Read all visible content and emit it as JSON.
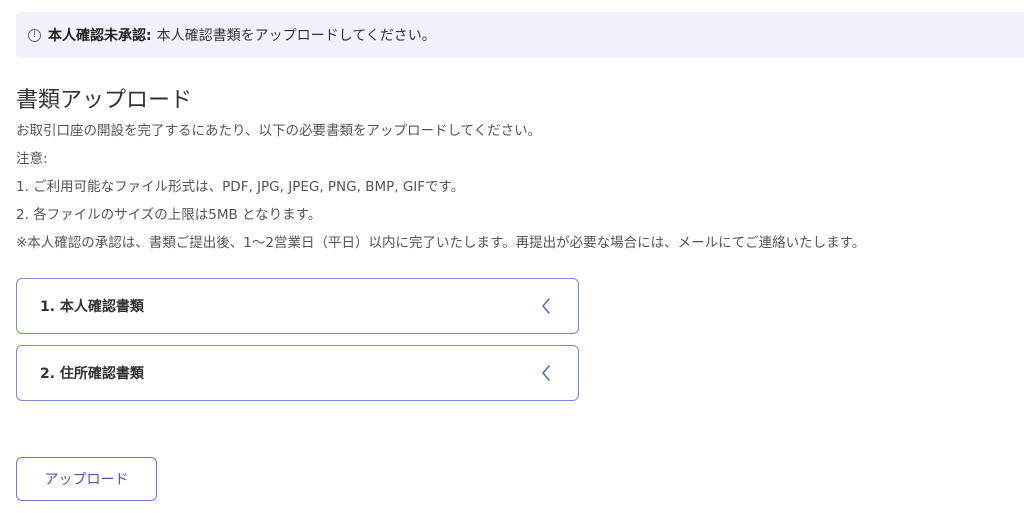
{
  "alert": {
    "icon": "info-circle-icon",
    "icon_glyph": "!",
    "title": "本人確認未承認:",
    "message": "本人確認書類をアップロードしてください。"
  },
  "page": {
    "heading": "書類アップロード",
    "description": "お取引口座の開設を完了するにあたり、以下の必要書類をアップロードしてください。",
    "notice_label": "注意:",
    "notes": [
      "1. ご利用可能なファイル形式は、PDF, JPG, JPEG, PNG, BMP, GIFです。",
      "2. 各ファイルのサイズの上限は5MB となります。",
      "※本人確認の承認は、書類ご提出後、1〜2営業日（平日）以内に完了いたします。再提出が必要な場合には、メールにてご連絡いたします。"
    ]
  },
  "documents": [
    {
      "label": "1. 本人確認書類",
      "icon": "chevron-left-icon"
    },
    {
      "label": "2. 住所確認書類",
      "icon": "chevron-left-icon"
    }
  ],
  "upload_button": {
    "label": "アップロード"
  },
  "colors": {
    "alert_bg": "#eff2fb",
    "accent_border": "#7d8bd0",
    "accent_text": "#4a5aa8"
  }
}
